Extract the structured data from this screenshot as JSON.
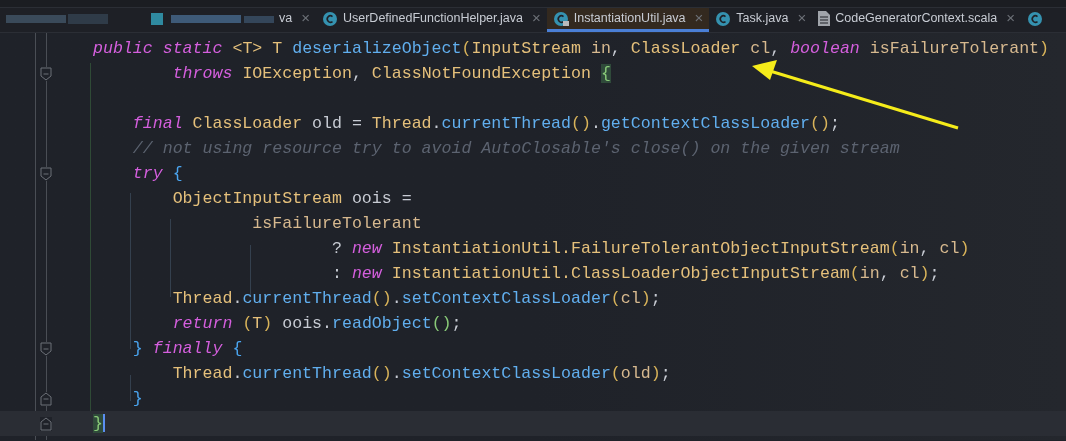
{
  "tabs": [
    {
      "kind": "redacted",
      "label": "va",
      "close": "×",
      "selected": false
    },
    {
      "kind": "class",
      "label": "UserDefinedFunctionHelper.java",
      "close": "×",
      "selected": false
    },
    {
      "kind": "class-locked",
      "label": "InstantiationUtil.java",
      "close": "×",
      "selected": true
    },
    {
      "kind": "class",
      "label": "Task.java",
      "close": "×",
      "selected": false
    },
    {
      "kind": "file",
      "label": "CodeGeneratorContext.scala",
      "close": "×",
      "selected": false
    },
    {
      "kind": "class-partial",
      "selected": false
    }
  ],
  "editor": {
    "lines": [
      {
        "kind": "code",
        "tokens": [
          {
            "kind": "kw",
            "text": "public static "
          },
          {
            "kind": "type",
            "text": "<T> T "
          },
          {
            "kind": "fn",
            "text": "deserializeObject"
          },
          {
            "kind": "paren",
            "text": "("
          },
          {
            "kind": "type",
            "text": "InputStream "
          },
          {
            "kind": "param",
            "text": "in"
          },
          {
            "kind": "plain",
            "text": ", "
          },
          {
            "kind": "type",
            "text": "ClassLoader "
          },
          {
            "kind": "param",
            "text": "cl"
          },
          {
            "kind": "plain",
            "text": ", "
          },
          {
            "kind": "kw",
            "text": "boolean "
          },
          {
            "kind": "param",
            "text": "isFailureTolerant"
          },
          {
            "kind": "paren",
            "text": ")"
          }
        ]
      },
      {
        "kind": "code",
        "fold": {
          "kind": "start"
        },
        "tokens": [
          {
            "kind": "kw",
            "text": "        throws "
          },
          {
            "kind": "type",
            "text": "IOException"
          },
          {
            "kind": "plain",
            "text": ", "
          },
          {
            "kind": "type",
            "text": "ClassNotFoundException "
          },
          {
            "kind": "match",
            "text": "{"
          }
        ]
      },
      {
        "kind": "blank"
      },
      {
        "kind": "code",
        "tokens": [
          {
            "kind": "kw",
            "text": "    final "
          },
          {
            "kind": "type",
            "text": "ClassLoader "
          },
          {
            "kind": "plain",
            "text": "old = "
          },
          {
            "kind": "type",
            "text": "Thread"
          },
          {
            "kind": "plain",
            "text": "."
          },
          {
            "kind": "fn",
            "text": "currentThread"
          },
          {
            "kind": "paren",
            "text": "()"
          },
          {
            "kind": "plain",
            "text": "."
          },
          {
            "kind": "fn",
            "text": "getContextClassLoader"
          },
          {
            "kind": "paren",
            "text": "()"
          },
          {
            "kind": "plain",
            "text": ";"
          }
        ]
      },
      {
        "kind": "code",
        "tokens": [
          {
            "kind": "comment",
            "text": "    // not using resource try to avoid AutoClosable's close() on the given stream"
          }
        ]
      },
      {
        "kind": "code",
        "fold": {
          "kind": "start"
        },
        "tokens": [
          {
            "kind": "kw",
            "text": "    try "
          },
          {
            "kind": "brace",
            "text": "{"
          }
        ]
      },
      {
        "kind": "code",
        "tokens": [
          {
            "kind": "type",
            "text": "        ObjectInputStream "
          },
          {
            "kind": "plain",
            "text": "oois ="
          }
        ]
      },
      {
        "kind": "code",
        "tokens": [
          {
            "kind": "param",
            "text": "                isFailureTolerant"
          }
        ]
      },
      {
        "kind": "code",
        "tokens": [
          {
            "kind": "plain",
            "text": "                        ? "
          },
          {
            "kind": "kw",
            "text": "new "
          },
          {
            "kind": "type",
            "text": "InstantiationUtil.FailureTolerantObjectInputStream"
          },
          {
            "kind": "paren",
            "text": "("
          },
          {
            "kind": "param",
            "text": "in"
          },
          {
            "kind": "plain",
            "text": ", "
          },
          {
            "kind": "param",
            "text": "cl"
          },
          {
            "kind": "paren",
            "text": ")"
          }
        ]
      },
      {
        "kind": "code",
        "tokens": [
          {
            "kind": "plain",
            "text": "                        : "
          },
          {
            "kind": "kw",
            "text": "new "
          },
          {
            "kind": "type",
            "text": "InstantiationUtil.ClassLoaderObjectInputStream"
          },
          {
            "kind": "paren",
            "text": "("
          },
          {
            "kind": "param",
            "text": "in"
          },
          {
            "kind": "plain",
            "text": ", "
          },
          {
            "kind": "param",
            "text": "cl"
          },
          {
            "kind": "paren",
            "text": ")"
          },
          {
            "kind": "plain",
            "text": ";"
          }
        ]
      },
      {
        "kind": "code",
        "tokens": [
          {
            "kind": "type",
            "text": "        Thread"
          },
          {
            "kind": "plain",
            "text": "."
          },
          {
            "kind": "fn",
            "text": "currentThread"
          },
          {
            "kind": "paren",
            "text": "()"
          },
          {
            "kind": "plain",
            "text": "."
          },
          {
            "kind": "fn",
            "text": "setContextClassLoader"
          },
          {
            "kind": "paren",
            "text": "("
          },
          {
            "kind": "param",
            "text": "cl"
          },
          {
            "kind": "paren",
            "text": ")"
          },
          {
            "kind": "plain",
            "text": ";"
          }
        ]
      },
      {
        "kind": "code",
        "tokens": [
          {
            "kind": "kw",
            "text": "        return "
          },
          {
            "kind": "paren",
            "text": "("
          },
          {
            "kind": "type",
            "text": "T"
          },
          {
            "kind": "paren",
            "text": ")"
          },
          {
            "kind": "plain",
            "text": " oois."
          },
          {
            "kind": "fn",
            "text": "readObject"
          },
          {
            "kind": "paren2",
            "text": "()"
          },
          {
            "kind": "plain",
            "text": ";"
          }
        ]
      },
      {
        "kind": "code",
        "fold": {
          "kind": "start"
        },
        "tokens": [
          {
            "kind": "brace",
            "text": "    } "
          },
          {
            "kind": "kw",
            "text": "finally "
          },
          {
            "kind": "brace",
            "text": "{"
          }
        ]
      },
      {
        "kind": "code",
        "tokens": [
          {
            "kind": "type",
            "text": "        Thread"
          },
          {
            "kind": "plain",
            "text": "."
          },
          {
            "kind": "fn",
            "text": "currentThread"
          },
          {
            "kind": "paren",
            "text": "()"
          },
          {
            "kind": "plain",
            "text": "."
          },
          {
            "kind": "fn",
            "text": "setContextClassLoader"
          },
          {
            "kind": "paren",
            "text": "("
          },
          {
            "kind": "param",
            "text": "old"
          },
          {
            "kind": "paren",
            "text": ")"
          },
          {
            "kind": "plain",
            "text": ";"
          }
        ]
      },
      {
        "kind": "code",
        "fold": {
          "kind": "end"
        },
        "tokens": [
          {
            "kind": "brace",
            "text": "    }"
          }
        ]
      },
      {
        "kind": "code",
        "fold": {
          "kind": "end"
        },
        "current": true,
        "tokens": [
          {
            "kind": "match",
            "text": "}"
          }
        ]
      }
    ]
  }
}
